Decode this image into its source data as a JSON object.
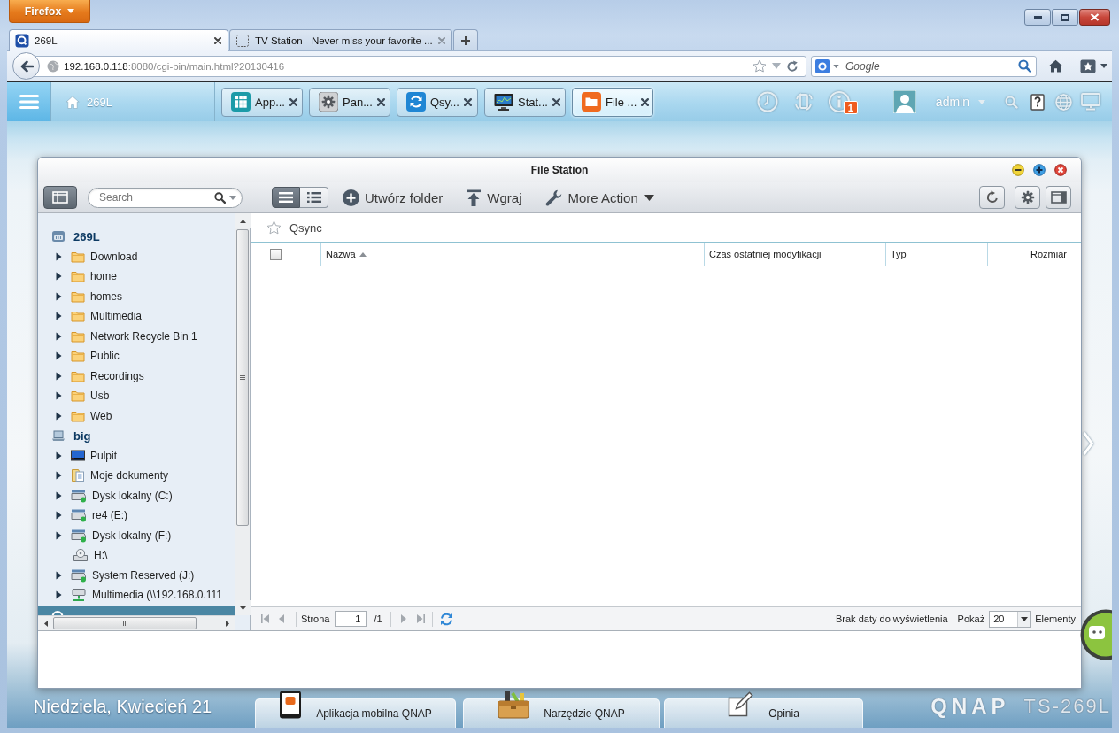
{
  "browser": {
    "menu_button": "Firefox",
    "tabs": [
      {
        "title": "269L",
        "kind": "nas",
        "selected": true
      },
      {
        "title": "TV Station - Never miss your favorite ...",
        "kind": "blank",
        "selected": false
      }
    ],
    "address": {
      "host": "192.168.0.118",
      "path": ":8080/cgi-bin/main.html?20130416"
    },
    "search": {
      "placeholder": "Google"
    }
  },
  "topbar": {
    "home": "269L",
    "apps": [
      {
        "label": "App...",
        "kind": "apps",
        "selected": false
      },
      {
        "label": "Pan...",
        "kind": "panel",
        "selected": false
      },
      {
        "label": "Qsy...",
        "kind": "qsync",
        "selected": false
      },
      {
        "label": "Stat...",
        "kind": "status",
        "selected": false
      },
      {
        "label": "File ...",
        "kind": "files",
        "selected": true
      }
    ],
    "notifications": "1",
    "user": "admin"
  },
  "window": {
    "title": "File Station",
    "search": {
      "placeholder": "Search"
    },
    "view_modes": [
      {
        "kind": "list",
        "selected": true
      },
      {
        "kind": "details",
        "selected": false
      }
    ],
    "actions": [
      {
        "label": "Utwórz folder",
        "kind": "create"
      },
      {
        "label": "Wgraj",
        "kind": "upload"
      },
      {
        "label": "More Action",
        "kind": "more"
      }
    ]
  },
  "tree": [
    {
      "label": "269L",
      "kind": "nas",
      "selected": false,
      "children": [
        {
          "label": "Download",
          "kind": "folder",
          "expandable": true,
          "selected": false
        },
        {
          "label": "home",
          "kind": "folder",
          "expandable": true,
          "selected": false
        },
        {
          "label": "homes",
          "kind": "folder",
          "expandable": true,
          "selected": false
        },
        {
          "label": "Multimedia",
          "kind": "folder",
          "expandable": true,
          "selected": false
        },
        {
          "label": "Network Recycle Bin 1",
          "kind": "folder",
          "expandable": true,
          "selected": false
        },
        {
          "label": "Public",
          "kind": "folder",
          "expandable": true,
          "selected": false
        },
        {
          "label": "Recordings",
          "kind": "folder",
          "expandable": true,
          "selected": false
        },
        {
          "label": "Usb",
          "kind": "folder",
          "expandable": true,
          "selected": false
        },
        {
          "label": "Web",
          "kind": "folder",
          "expandable": true,
          "selected": false
        }
      ]
    },
    {
      "label": "big",
      "kind": "computer",
      "selected": false,
      "children": [
        {
          "label": "Pulpit",
          "kind": "desktop",
          "expandable": true,
          "selected": false
        },
        {
          "label": "Moje dokumenty",
          "kind": "documents",
          "expandable": true,
          "selected": false
        },
        {
          "label": "Dysk lokalny (C:)",
          "kind": "drive",
          "expandable": true,
          "selected": false
        },
        {
          "label": "re4 (E:)",
          "kind": "drive",
          "expandable": true,
          "selected": false
        },
        {
          "label": "Dysk lokalny (F:)",
          "kind": "drive",
          "expandable": true,
          "selected": false
        },
        {
          "label": "H:\\",
          "kind": "optical",
          "expandable": false,
          "selected": false
        },
        {
          "label": "System Reserved (J:)",
          "kind": "drive",
          "expandable": true,
          "selected": false
        },
        {
          "label": "Multimedia (\\\\192.168.0.111",
          "kind": "network",
          "expandable": true,
          "selected": false
        }
      ]
    },
    {
      "kind": "qsync",
      "selected": true
    }
  ],
  "list": {
    "path": "Qsync",
    "favorite": false,
    "select_all": {
      "checked": false
    },
    "columns": [
      {
        "label": "Nazwa",
        "sorted": true
      },
      {
        "label": "Czas ostatniej modyfikacji",
        "sorted": false
      },
      {
        "label": "Typ",
        "sorted": false
      },
      {
        "label": "Rozmiar",
        "sorted": false
      }
    ]
  },
  "pager": {
    "page_label": "Strona",
    "page": "1",
    "total": "/1",
    "status": "Brak daty do wyświetlenia",
    "page_size_label": "Pokaż",
    "page_size": "20",
    "items_label": "Elementy"
  },
  "desktop": {
    "date": "Niedziela, Kwiecień 21",
    "dock": [
      {
        "label": "Aplikacja mobilna QNAP",
        "kind": "mobile"
      },
      {
        "label": "Narzędzie QNAP",
        "kind": "toolbox"
      },
      {
        "label": "Opinia",
        "kind": "feedback"
      }
    ],
    "brand": "QNAP",
    "model": "TS-269L"
  }
}
